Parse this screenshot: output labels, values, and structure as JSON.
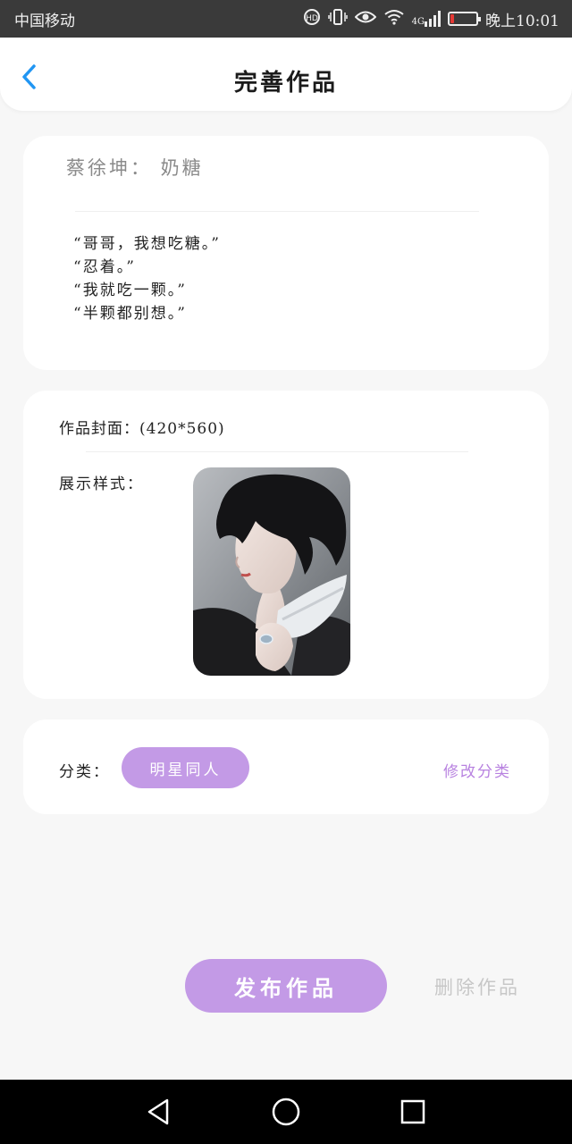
{
  "status_bar": {
    "carrier": "中国移动",
    "network": "4G",
    "time": "晚上10:01",
    "battery_level": 0.12,
    "icons": [
      "hd-call-icon",
      "vibrate-icon",
      "eye-icon",
      "wifi-icon",
      "signal-icon",
      "battery-icon"
    ]
  },
  "header": {
    "title": "完善作品",
    "back_icon": "chevron-left-icon"
  },
  "work": {
    "title": "蔡徐坤：  奶糖",
    "lines": [
      "“哥哥，我想吃糖。”",
      "“忍着。”",
      "“我就吃一颗。”",
      "“半颗都别想。”"
    ]
  },
  "cover": {
    "label": "作品封面：(420*560)",
    "style_label": "展示样式："
  },
  "category": {
    "label": "分类：",
    "value": "明星同人",
    "edit_label": "修改分类"
  },
  "actions": {
    "publish_label": "发布作品",
    "delete_label": "删除作品"
  },
  "colors": {
    "accent": "#c39ae6",
    "edit_link": "#b882e0",
    "back_arrow": "#2196f3",
    "muted": "#c7c7c7"
  }
}
